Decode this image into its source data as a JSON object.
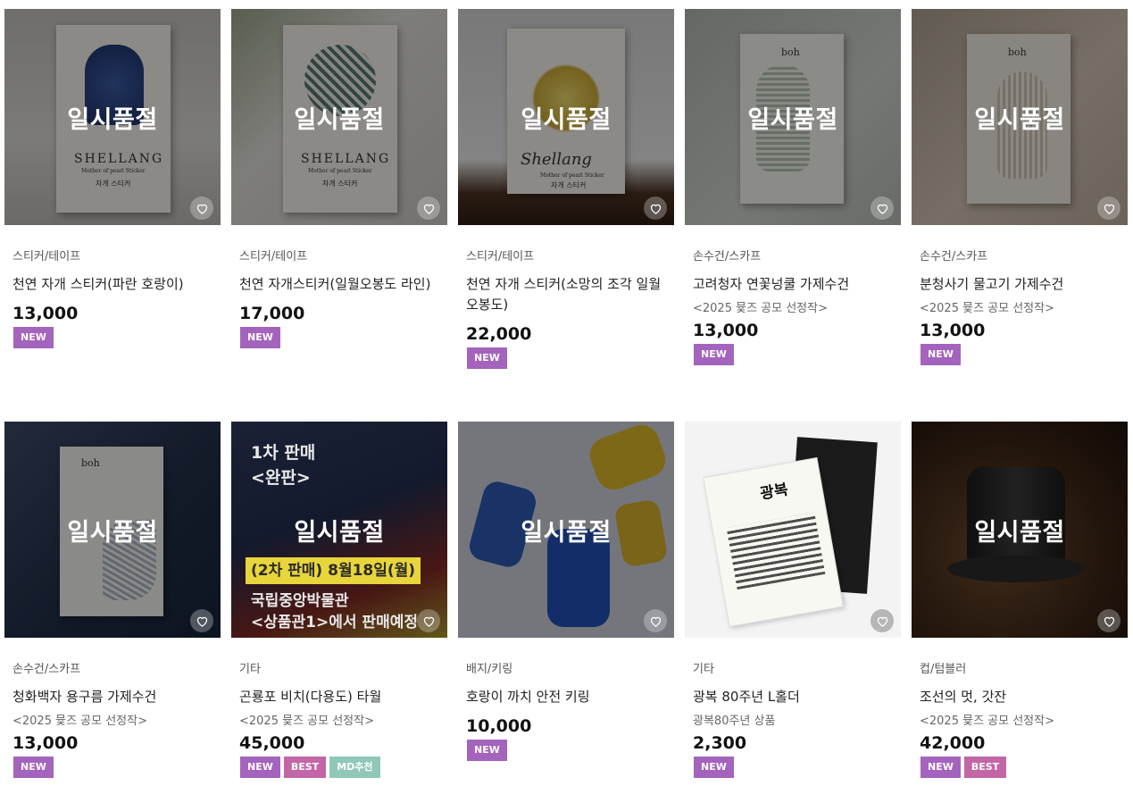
{
  "soldout_label": "일시품절",
  "products": [
    {
      "category": "스티커/테이프",
      "name": "천연 자개 스티커(파란 호랑이)",
      "subtitle": "",
      "price": "13,000",
      "badges": [
        "NEW"
      ],
      "image_text": [
        "SHELLANG",
        "Mother of pearl Sticker",
        "자개 스티커"
      ]
    },
    {
      "category": "스티커/테이프",
      "name": "천연 자개스티커(일월오봉도 라인)",
      "subtitle": "",
      "price": "17,000",
      "badges": [
        "NEW"
      ],
      "image_text": [
        "SHELLANG",
        "Mother of pearl Sticker",
        "자개 스티커"
      ]
    },
    {
      "category": "스티커/테이프",
      "name": "천연 자개 스티커(소망의 조각 일월오봉도)",
      "subtitle": "",
      "price": "22,000",
      "badges": [
        "NEW"
      ],
      "image_text": [
        "Shellang",
        "Mother of pearl Sticker",
        "자개 스티커"
      ]
    },
    {
      "category": "손수건/스카프",
      "name": "고려청자 연꽃넝쿨 가제수건",
      "subtitle": "<2025 뮻즈 공모 선정작>",
      "price": "13,000",
      "badges": [
        "NEW"
      ],
      "image_text": [
        "boh"
      ]
    },
    {
      "category": "손수건/스카프",
      "name": "분청사기 물고기 가제수건",
      "subtitle": "<2025 뮻즈 공모 선정작>",
      "price": "13,000",
      "badges": [
        "NEW"
      ],
      "image_text": [
        "boh"
      ]
    },
    {
      "category": "손수건/스카프",
      "name": "청화백자 용구름 가제수건",
      "subtitle": "<2025 뮻즈 공모 선정작>",
      "price": "13,000",
      "badges": [
        "NEW"
      ],
      "image_text": [
        "boh"
      ]
    },
    {
      "category": "기타",
      "name": "곤룡포 비치(다용도) 타월",
      "subtitle": "<2025 뮻즈 공모 선정작>",
      "price": "45,000",
      "badges": [
        "NEW",
        "BEST",
        "MD추천"
      ],
      "image_text": [
        "1차 판매",
        "<완판>",
        "(2차 판매) 8월18일(월)",
        "국립중앙박물관",
        "<상품관1>에서 판매예정"
      ]
    },
    {
      "category": "배지/키링",
      "name": "호랑이 까치 안전 키링",
      "subtitle": "",
      "price": "10,000",
      "badges": [
        "NEW"
      ],
      "image_text": []
    },
    {
      "category": "기타",
      "name": "광복 80주년 L홀더",
      "subtitle": "광복80주년 상품",
      "price": "2,300",
      "badges": [
        "NEW"
      ],
      "image_text": [
        "광복"
      ]
    },
    {
      "category": "컵/텀블러",
      "name": "조선의 멋, 갓잔",
      "subtitle": "<2025 뮻즈 공모 선정작>",
      "price": "42,000",
      "badges": [
        "NEW",
        "BEST"
      ],
      "image_text": []
    }
  ],
  "soldout_flags": [
    true,
    true,
    true,
    true,
    true,
    true,
    true,
    true,
    false,
    true
  ],
  "colors": {
    "new_badge": "#a463bd",
    "best_badge": "#c266a6",
    "md_badge": "#8fc7b9"
  }
}
